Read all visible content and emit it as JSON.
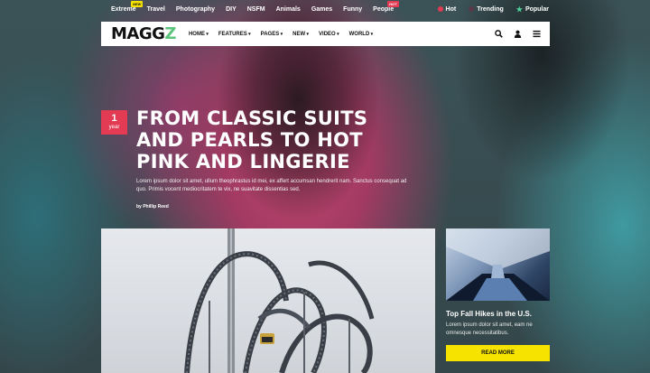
{
  "topbar": {
    "links": [
      {
        "label": "Extreme",
        "badge": "NEW"
      },
      {
        "label": "Travel"
      },
      {
        "label": "Photography"
      },
      {
        "label": "DIY"
      },
      {
        "label": "NSFM"
      },
      {
        "label": "Animals"
      },
      {
        "label": "Games"
      },
      {
        "label": "Funny"
      },
      {
        "label": "People",
        "badge": "HOT"
      }
    ],
    "right": [
      {
        "label": "Hot",
        "icon": "hot-dot-icon"
      },
      {
        "label": "Trending",
        "icon": "trending-dot-icon"
      },
      {
        "label": "Popular",
        "icon": "star-icon"
      }
    ]
  },
  "nav": {
    "logo_main": "MAGG",
    "logo_accent": "Z",
    "menu": [
      "HOME",
      "FEATURES",
      "PAGES",
      "NEW",
      "VIDEO",
      "WORLD"
    ],
    "tools": [
      "search-icon",
      "user-icon",
      "menu-icon"
    ]
  },
  "hero": {
    "badge_number": "1",
    "badge_unit": "year",
    "headline": "FROM CLASSIC SUITS AND PEARLS TO HOT PINK AND LINGERIE",
    "excerpt": "Lorem ipsum dolor sit amet, ullum theophrastus id mei, ex affert accumsan hendrerit nam. Sanctus consequat ad quo. Primis vocent mediocritatem te vix, ne suavitate dissentias sed.",
    "byline": "by Phillip Reed"
  },
  "card": {
    "title": "Top Fall Hikes in the U.S.",
    "text": "Lorem ipsum dolor sit amet, eam ne omnesque necessitatibus.",
    "button": "READ MORE"
  },
  "colors": {
    "accent_red": "#e23b53",
    "accent_yellow": "#f6e400",
    "logo_green": "#5bc47c"
  }
}
